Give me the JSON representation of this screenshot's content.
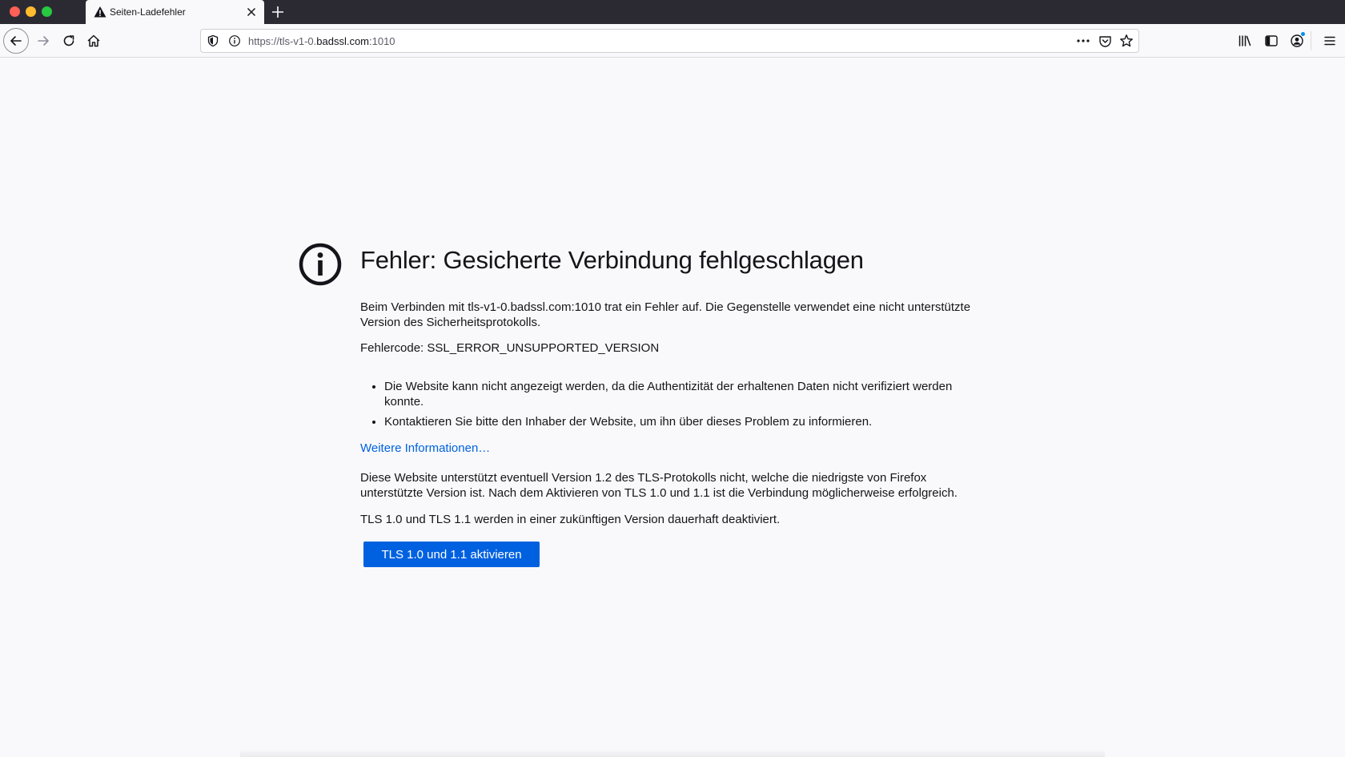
{
  "browser": {
    "tab": {
      "title": "Seiten-Ladefehler",
      "icon": "warning-triangle-icon"
    },
    "urlbar": {
      "url_prefix": "https://tls-v1-0.",
      "url_host": "badssl.com",
      "url_suffix": ":1010"
    },
    "toolbar_icons": [
      "back-arrow-icon",
      "forward-arrow-icon",
      "reload-icon",
      "home-icon",
      "library-icon",
      "sidebar-icon",
      "account-icon",
      "hamburger-menu-icon"
    ],
    "accent_color": "#0061e0"
  },
  "page": {
    "icon": "info-circle-icon",
    "title": "Fehler: Gesicherte Verbindung fehlgeschlagen",
    "connect_text": "Beim Verbinden mit tls-v1-0.badssl.com:1010 trat ein Fehler auf. Die Gegenstelle verwendet eine nicht unterstützte Version des Sicherheitsprotokolls.",
    "error_code": "Fehlercode: SSL_ERROR_UNSUPPORTED_VERSION",
    "bullets": [
      "Die Website kann nicht angezeigt werden, da die Authentizität der erhaltenen Daten nicht verifiziert werden konnte.",
      "Kontaktieren Sie bitte den Inhaber der Website, um ihn über dieses Problem zu informieren."
    ],
    "learn_more": "Weitere Informationen…",
    "tls_text": "Diese Website unterstützt eventuell Version 1.2 des TLS-Protokolls nicht, welche die niedrigste von Firefox unterstützte Version ist. Nach dem Aktivieren von TLS 1.0 und 1.1 ist die Verbindung möglicherweise erfolgreich.",
    "tls_deprecation": "TLS 1.0 und TLS 1.1 werden in einer zukünftigen Version dauerhaft deaktiviert.",
    "button_label": "TLS 1.0 und 1.1 aktivieren"
  }
}
